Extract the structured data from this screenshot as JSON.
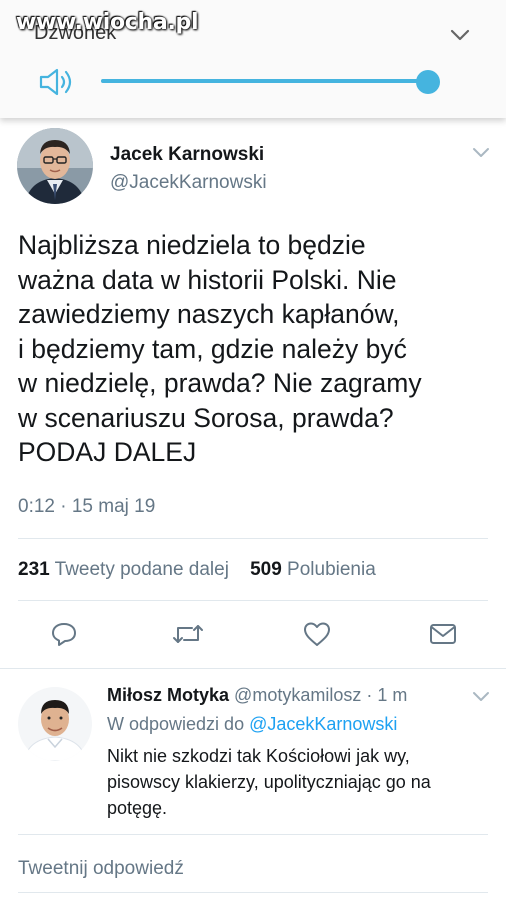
{
  "watermark": "www.wiocha.pl",
  "volume_panel": {
    "title": "Dzwonek",
    "level_fraction": 1.0,
    "accent_color": "#45b4df",
    "icons": [
      "speaker-icon",
      "chevron-down-icon"
    ]
  },
  "tweet": {
    "author_name": "Jacek Karnowski",
    "author_handle": "@JacekKarnowski",
    "text": "Najbliższa niedziela to będzie\nważna data w historii Polski. Nie\nzawiedziemy naszych kapłanów,\ni będziemy tam, gdzie należy być\nw niedzielę, prawda? Nie zagramy\nw scenariuszu Sorosa, prawda?\nPODAJ DALEJ",
    "timestamp": "0:12 · 15 maj 19",
    "retweets_count": "231",
    "retweets_label": "Tweety podane dalej",
    "likes_count": "509",
    "likes_label": "Polubienia",
    "actions": [
      "reply-icon",
      "retweet-icon",
      "like-icon",
      "message-icon"
    ]
  },
  "reply": {
    "author_name": "Miłosz Motyka",
    "author_handle": "@motykamilosz",
    "time": "· 1 m",
    "in_reply_to_label": "W odpowiedzi do",
    "in_reply_to_handle": "@JacekKarnowski",
    "text": "Nikt nie szkodzi tak Kościołowi jak wy,\npisowscy klakierzy, upolityczniając go na\npotęgę."
  },
  "reply_box": {
    "placeholder": "Tweetnij odpowiedź"
  },
  "colors": {
    "text": "#14171a",
    "secondary": "#657786",
    "link": "#1da1f2",
    "divider": "#e1e8ed"
  }
}
